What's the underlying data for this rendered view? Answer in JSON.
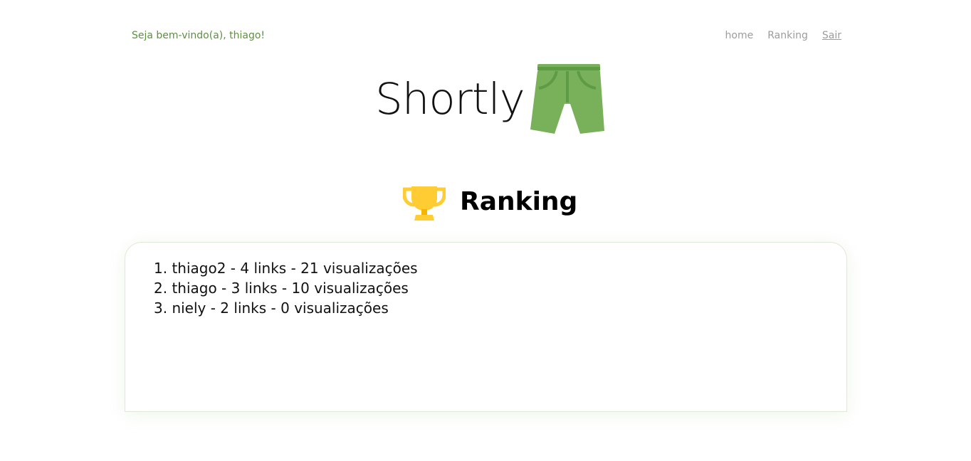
{
  "header": {
    "welcome": "Seja bem-vindo(a), thiago!",
    "nav": {
      "home": "home",
      "ranking": "Ranking",
      "logout": "Sair"
    }
  },
  "brand": {
    "name": "Shortly",
    "logo_icon": "shorts-icon",
    "logo_color": "#78b159"
  },
  "ranking": {
    "title": "Ranking",
    "icon": "trophy-icon",
    "icon_color": "#ffcc33",
    "items": [
      "1. thiago2 - 4 links - 21 visualizações",
      "2. thiago - 3 links - 10 visualizações",
      "3. niely - 2 links - 0 visualizações"
    ]
  }
}
